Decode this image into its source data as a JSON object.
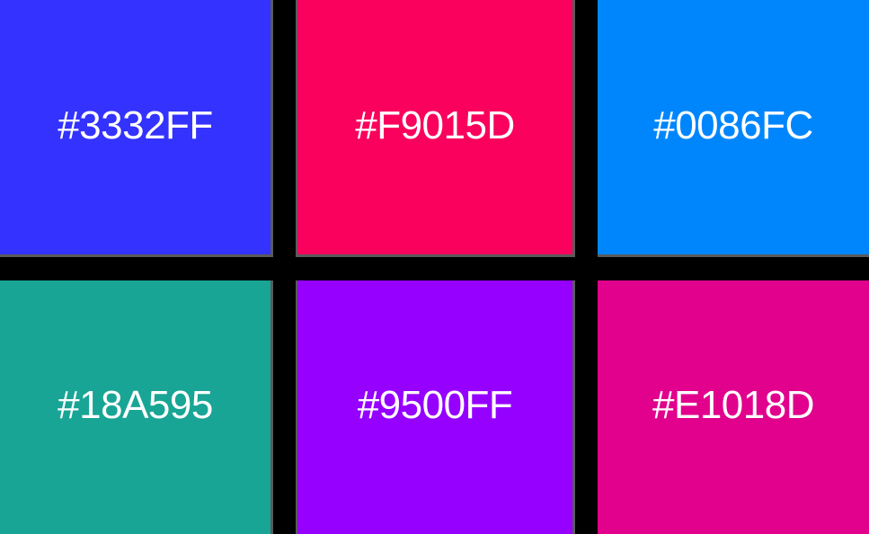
{
  "swatches": [
    {
      "label": "#3332FF",
      "color": "#3332FF"
    },
    {
      "label": "#F9015D",
      "color": "#F9015D"
    },
    {
      "label": "#0086FC",
      "color": "#0086FC"
    },
    {
      "label": "#18A595",
      "color": "#18A595"
    },
    {
      "label": "#9500FF",
      "color": "#9500FF"
    },
    {
      "label": "#E1018D",
      "color": "#E1018D"
    }
  ]
}
